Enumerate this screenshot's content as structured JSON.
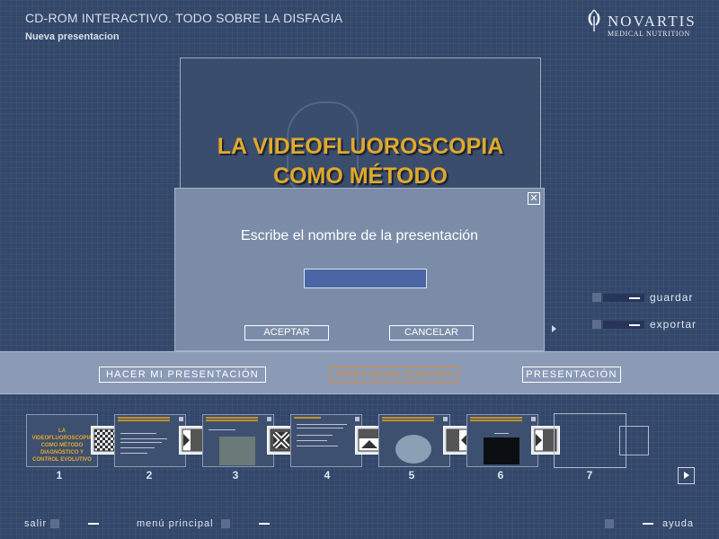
{
  "header": {
    "app_title": "CD-ROM INTERACTIVO. TODO SOBRE LA DISFAGIA",
    "subtitle": "Nueva presentacion",
    "brand": {
      "name": "NOVARTIS",
      "sub": "MEDICAL NUTRITION"
    }
  },
  "preview": {
    "title_line1": "LA VIDEOFLUOROSCOPIA",
    "title_line2": "COMO MÉTODO"
  },
  "dialog": {
    "prompt": "Escribe el nombre de la presentación",
    "input_value": "",
    "close_icon": "close-icon",
    "accept_label": "ACEPTAR",
    "cancel_label": "CANCELAR"
  },
  "side_actions": {
    "save_label": "guardar",
    "export_label": "exportar"
  },
  "modes": {
    "create": "HACER MI PRESENTACIÓN",
    "preview": "PREVISUALIZACIÓN",
    "present": "PRESENTACIÓN",
    "active": "PREVISUALIZACIÓN",
    "active_color": "#e08a2c"
  },
  "filmstrip": {
    "slide_numbers": [
      "1",
      "2",
      "3",
      "4",
      "5",
      "6",
      "7"
    ],
    "thumb1_text": "LA VIDEOFLUOROSCOPIA COMO MÉTODO DIAGNÓSTICO Y CONTROL EVOLUTIVO",
    "transitions": [
      "checkerboard-icon",
      "wipe-right-icon",
      "box-in-icon",
      "wipe-up-icon",
      "wipe-left-icon",
      "wipe-right-icon"
    ]
  },
  "footer": {
    "exit_label": "salir",
    "menu_label": "menú principal",
    "help_label": "ayuda"
  },
  "colors": {
    "background": "#33476a",
    "dialog": "#7b8ca8",
    "accent_orange": "#e08a2c",
    "title_gold": "#e0a92a"
  }
}
